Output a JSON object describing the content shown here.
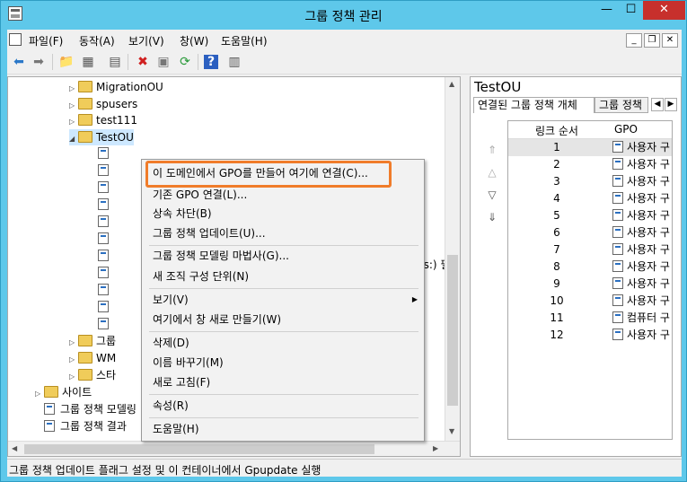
{
  "window": {
    "title": "그룹 정책 관리"
  },
  "menu": [
    "파일(F)",
    "동작(A)",
    "보기(V)",
    "창(W)",
    "도움말(H)"
  ],
  "toolbar": {
    "icons": [
      "back-arrow-icon",
      "forward-arrow-icon",
      "up-folder-icon",
      "show-tree-icon",
      "properties-icon",
      "delete-icon",
      "export-icon",
      "refresh-icon",
      "help-icon",
      "console-icon"
    ]
  },
  "tree": {
    "items": [
      {
        "label": "MigrationOU"
      },
      {
        "label": "spusers"
      },
      {
        "label": "test111"
      },
      {
        "label": "TestOU"
      },
      {
        "label": "그룹"
      },
      {
        "label": "WM"
      },
      {
        "label": "스타"
      },
      {
        "label": "사이트"
      },
      {
        "label": "그룹 정책 모델링"
      },
      {
        "label": "그룹 정책 결과"
      }
    ],
    "partial_text": "ps:) 필"
  },
  "context_menu": {
    "items": [
      "이 도메인에서 GPO를 만들어 여기에 연결(C)...",
      "기존 GPO 연결(L)...",
      "상속 차단(B)",
      "그룹 정책 업데이트(U)...",
      "그룹 정책 모델링 마법사(G)...",
      "새 조직 구성 단위(N)",
      "보기(V)",
      "여기에서 창 새로 만들기(W)",
      "삭제(D)",
      "이름 바꾸기(M)",
      "새로 고침(F)",
      "속성(R)",
      "도움말(H)"
    ]
  },
  "right_pane": {
    "title": "TestOU",
    "tabs": [
      "연결된 그룹 정책 개체",
      "그룹 정책"
    ],
    "columns": [
      "링크 순서",
      "GPO"
    ],
    "rows": [
      {
        "order": "1",
        "gpo": "사용자 구"
      },
      {
        "order": "2",
        "gpo": "사용자 구"
      },
      {
        "order": "3",
        "gpo": "사용자 구"
      },
      {
        "order": "4",
        "gpo": "사용자 구"
      },
      {
        "order": "5",
        "gpo": "사용자 구"
      },
      {
        "order": "6",
        "gpo": "사용자 구"
      },
      {
        "order": "7",
        "gpo": "사용자 구"
      },
      {
        "order": "8",
        "gpo": "사용자 구"
      },
      {
        "order": "9",
        "gpo": "사용자 구"
      },
      {
        "order": "10",
        "gpo": "사용자 구"
      },
      {
        "order": "11",
        "gpo": "컴퓨터 구"
      },
      {
        "order": "12",
        "gpo": "사용자 구"
      }
    ]
  },
  "status": "그룹 정책 업데이트 플래그 설정 및 이 컨테이너에서 Gpupdate 실행",
  "colors": {
    "titlebar": "#5ec8ea",
    "close": "#c7302c",
    "highlight": "#f07c2a"
  }
}
